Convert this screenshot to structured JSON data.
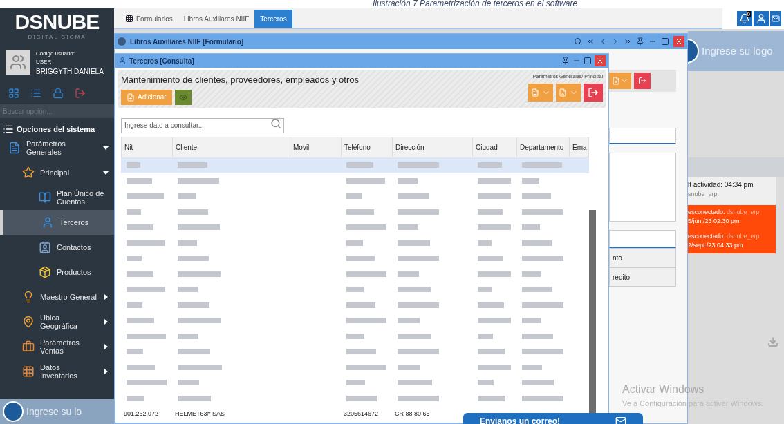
{
  "caption": "Ilustración 7 Parametrización de terceros en el software",
  "sidebar": {
    "logo": "DSNUBE",
    "logo_tagline": "DIGITAL SIGMA",
    "user": {
      "label": "Código usuario:",
      "code": "USER",
      "name": "BRIGGYTH DANIELA"
    },
    "search": {
      "placeholder": "Buscar opción..."
    },
    "menu_title": "Opciones del sistema",
    "tree": [
      {
        "label": "Parámetros Generales",
        "expanded": true,
        "children": [
          {
            "label": "Principal",
            "expanded": true,
            "children": [
              {
                "label": "Plan Único de Cuentas",
                "selected": false
              },
              {
                "label": "Terceros",
                "selected": true
              },
              {
                "label": "Contactos",
                "selected": false
              },
              {
                "label": "Productos",
                "selected": false
              }
            ]
          },
          {
            "label": "Maestro General",
            "expanded": false
          },
          {
            "label": "Ubica Geográfica",
            "expanded": false
          },
          {
            "label": "Parámetros Ventas",
            "expanded": false
          },
          {
            "label": "Datos Inventarios",
            "expanded": false
          }
        ]
      }
    ],
    "footer_logo": "Ingrese su lo"
  },
  "tabs": [
    {
      "label": "Formularios",
      "selected": false
    },
    {
      "label": "Libros Auxiliares NIIF",
      "selected": false
    },
    {
      "label": "Terceros",
      "selected": true
    }
  ],
  "top_badge": "0",
  "back_window": {
    "title": "Libros Auxiliares NIIF [Formulario]",
    "list_items": [
      "nto",
      "redito"
    ]
  },
  "window": {
    "title": "Terceros [Consulta]",
    "heading": "Mantenimiento de clientes, proveedores, empleados y otros",
    "breadcrumb": "Parámetros Generales/ Principal",
    "add_button": "Adicionar",
    "search": {
      "placeholder": "Ingrese dato a consultar..."
    }
  },
  "table": {
    "columns": [
      "Nit",
      "Cliente",
      "Movil",
      "Teléfono",
      "Dirección",
      "Ciudad",
      "Departamento",
      "Ema"
    ],
    "rows": [
      {
        "kind": "blurred",
        "selected": true
      },
      {
        "kind": "blurred",
        "selected": false
      },
      {
        "kind": "blurred",
        "selected": false
      },
      {
        "kind": "blurred",
        "selected": false
      },
      {
        "kind": "blurred",
        "selected": false
      },
      {
        "kind": "blurred",
        "selected": false
      },
      {
        "kind": "blurred",
        "selected": false
      },
      {
        "kind": "blurred",
        "selected": false
      },
      {
        "kind": "blurred",
        "selected": false
      },
      {
        "kind": "blurred",
        "selected": false
      },
      {
        "kind": "blurred",
        "selected": false
      },
      {
        "kind": "blurred",
        "selected": false
      },
      {
        "kind": "blurred",
        "selected": false
      },
      {
        "kind": "blurred",
        "selected": false
      },
      {
        "kind": "blurred",
        "selected": false
      },
      {
        "kind": "blurred",
        "selected": false
      },
      {
        "kind": "text",
        "selected": false,
        "cells": [
          "901.262.072",
          "HELMET63# SAS",
          "",
          "3205614672",
          "CR 88 80 65",
          "",
          "",
          ""
        ]
      }
    ]
  },
  "right_panel": {
    "logo": "Ingrese su logo",
    "activity": "lt actividad: 04:34 pm",
    "activity_user": "snube_erp",
    "alerts": [
      {
        "status": "esconectado:",
        "user": "dsnube_erp",
        "time": "5/jun./23 02:30 pm"
      },
      {
        "status": "esconectado:",
        "user": "dsnube_erp",
        "time": "2/sept./23 04:33 pm"
      }
    ]
  },
  "contact_tab": "Envíanos un correo!",
  "os_notice": {
    "title": "Activar Windows",
    "text": "Ve a Configuración para activar Windows."
  }
}
